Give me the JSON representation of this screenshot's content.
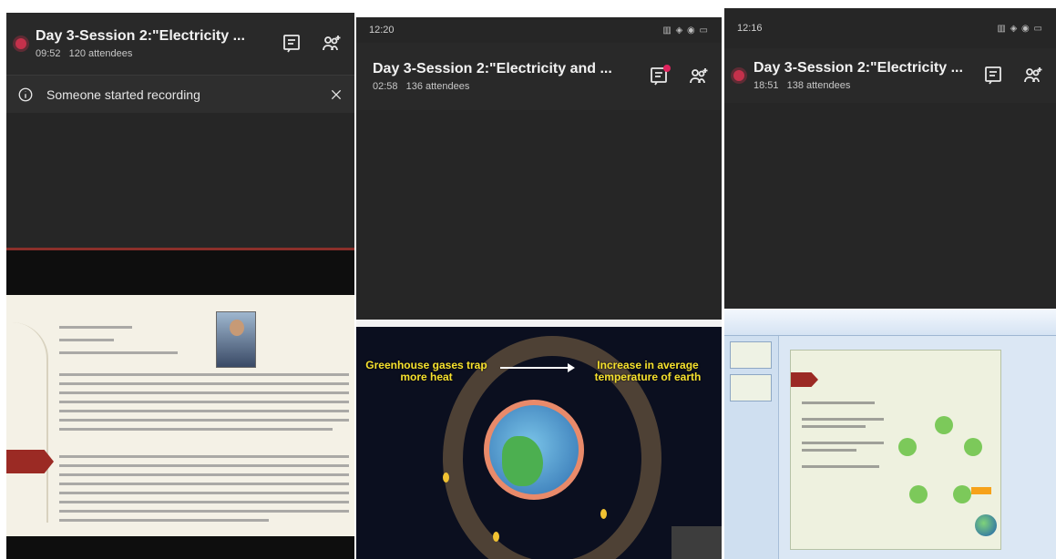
{
  "panels": [
    {
      "status_bar": null,
      "title": "Day 3-Session 2:\"Electricity ...",
      "duration": "09:52",
      "attendees": "120 attendees",
      "banner": {
        "text": "Someone started recording",
        "close_icon": "close-icon",
        "info_icon": "info-icon"
      },
      "icons": [
        "chat-icon",
        "add-people-icon"
      ]
    },
    {
      "status_bar": {
        "time": "12:20",
        "left_icons": "signal",
        "right_icons": "battery"
      },
      "title": "Day 3-Session 2:\"Electricity and ...",
      "duration": "02:58",
      "attendees": "136 attendees",
      "slide": {
        "left_caption": "Greenhouse gases trap more heat",
        "right_caption": "Increase in average temperature of earth"
      },
      "icons": [
        "chat-icon",
        "add-people-icon"
      ],
      "chat_badge": true
    },
    {
      "status_bar": {
        "time": "12:16",
        "left_icons": "signal",
        "right_icons": "battery"
      },
      "title": "Day 3-Session 2:\"Electricity ...",
      "duration": "18:51",
      "attendees": "138 attendees",
      "icons": [
        "chat-icon",
        "add-people-icon"
      ]
    }
  ],
  "colors": {
    "recording_dot": "#c4314b",
    "background": "#1f1f1f",
    "header": "#292929",
    "caption_yellow": "#f6e12e"
  }
}
